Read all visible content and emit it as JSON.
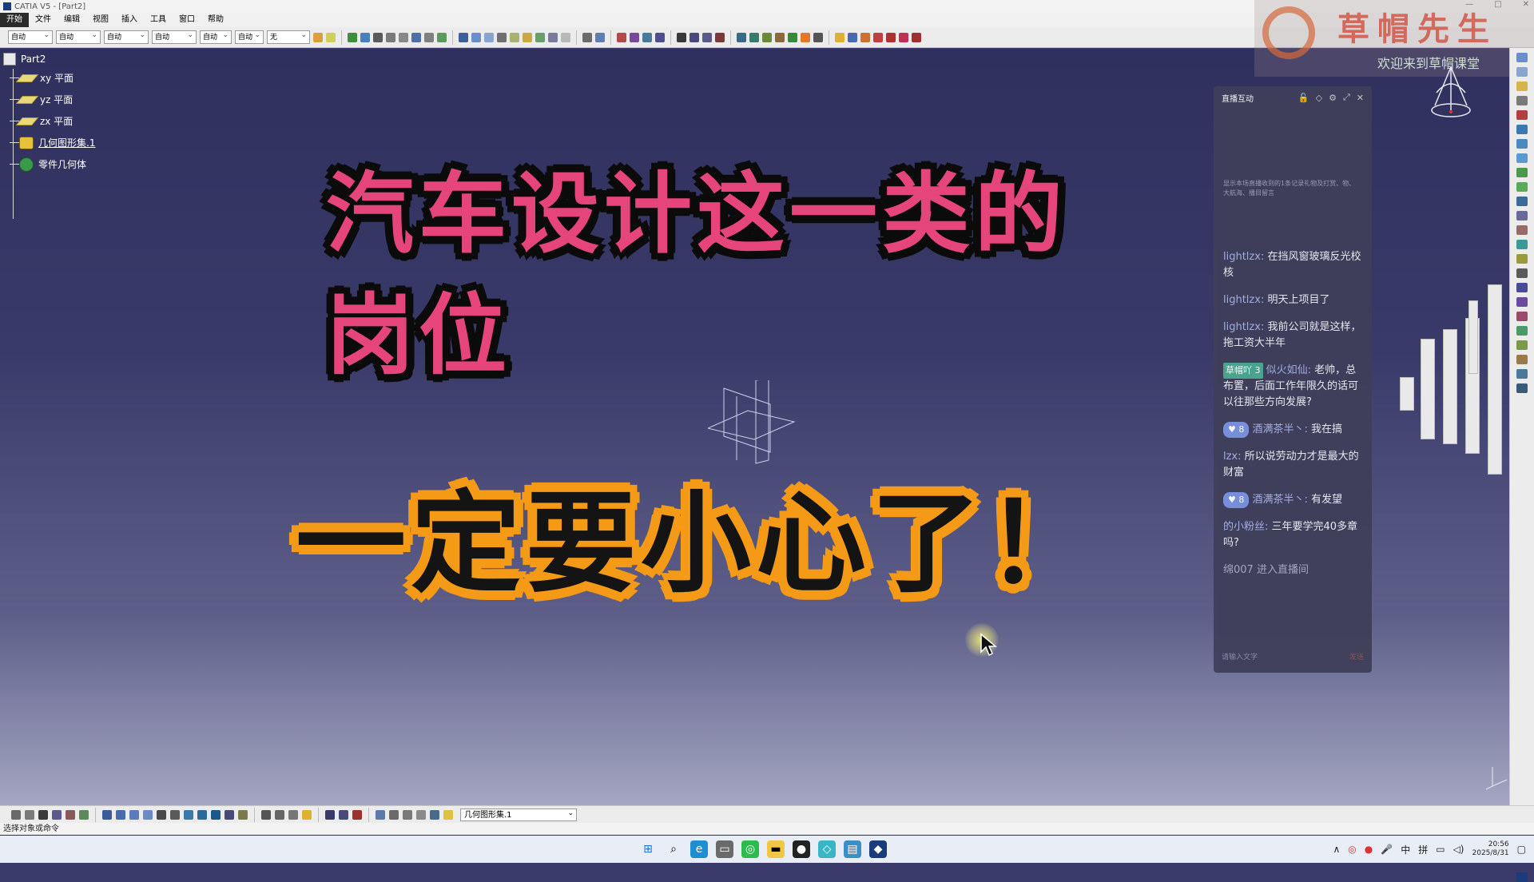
{
  "window": {
    "title": "CATIA V5 - [Part2]"
  },
  "menu": [
    "开始",
    "文件",
    "编辑",
    "视图",
    "插入",
    "工具",
    "窗口",
    "帮助"
  ],
  "toolbar": {
    "selects": [
      "自动",
      "自动",
      "自动",
      "自动",
      "自动",
      "自动",
      "无"
    ]
  },
  "tree": {
    "root": "Part2",
    "items": [
      "xy 平面",
      "yz 平面",
      "zx 平面",
      "几何图形集.1",
      "零件几何体"
    ]
  },
  "overlay": {
    "line1": "汽车设计这一类的",
    "line2": "岗位",
    "line3": "一定要小心了！"
  },
  "chat": {
    "title": "直播互动",
    "hint": "显示本场直播收到的1条记录礼物及打赏、物、大航海、播目留言",
    "messages": [
      {
        "user": "lightlzx:",
        "text": "在挡风窗玻璃反光校核"
      },
      {
        "user": "lightlzx:",
        "text": "明天上项目了"
      },
      {
        "user": "lightlzx:",
        "text": "我前公司就是这样，拖工资大半年"
      },
      {
        "badge": "草帽吖",
        "badge_level": "3",
        "user": "似火如仙:",
        "text": "老帅，总布置，后面工作年限久的话可以往那些方向发展?"
      },
      {
        "lvl": "8",
        "user": "酒满茶半丶:",
        "text": "我在搞"
      },
      {
        "user": "lzx:",
        "text": "所以说劳动力才是最大的财富"
      },
      {
        "lvl": "8",
        "user": "酒满茶半丶:",
        "text": "有发望"
      },
      {
        "user": "的小粉丝:",
        "text": "三年要学完40多章吗?"
      },
      {
        "user": "",
        "text": "绵007 进入直播间"
      }
    ],
    "input_placeholder": "请输入文字",
    "send": "发送"
  },
  "watermark": {
    "brand": "草帽先生",
    "tagline": "欢迎来到草帽课堂"
  },
  "bottom": {
    "geoset_select": "几何图形集.1"
  },
  "status": {
    "text": "选择对象或命令"
  },
  "clock": {
    "time": "20:56",
    "date": "2025/8/31"
  },
  "tray": {
    "ime1": "中",
    "ime2": "拼"
  },
  "colors": {
    "pink": "#e6457c",
    "orange": "#f59a16",
    "bg": "#3b3b6b"
  }
}
